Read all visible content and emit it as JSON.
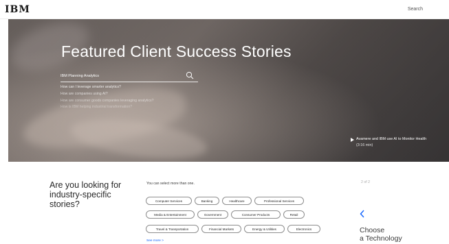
{
  "nav": {
    "logo": "IBM",
    "search": "Search"
  },
  "hero": {
    "title": "Featured Client Success Stories",
    "search_value": "IBM Planning Analytics",
    "suggestions": [
      "How can I leverage smarter analytics?",
      "How are companies using AI?",
      "How are consumer goods companies leveraging analytics?",
      "How is IBM helping industrial transformation?"
    ],
    "video": {
      "title": "Avamere and IBM use AI to Monitor Health",
      "duration": "(3:16 min)"
    }
  },
  "industry": {
    "heading_lines": [
      "Are you looking for",
      "industry-specific",
      "stories?"
    ],
    "helper": "You can select more than one.",
    "chips": [
      "Computer Services",
      "Banking",
      "Healthcare",
      "Professional Services",
      "Media & Entertainment",
      "Government",
      "Consumer Products",
      "Retail",
      "Travel & Transportation",
      "Financial Markets",
      "Energy & Utilities",
      "Electronics"
    ],
    "see_more": "See more >"
  },
  "side": {
    "pager": "2 of 2",
    "choose_lines": [
      "Choose",
      "a Technology"
    ]
  },
  "colors": {
    "accent": "#0f62fe",
    "text": "#161616"
  },
  "icons": [
    "search-icon",
    "play-icon",
    "chevron-left-icon"
  ]
}
